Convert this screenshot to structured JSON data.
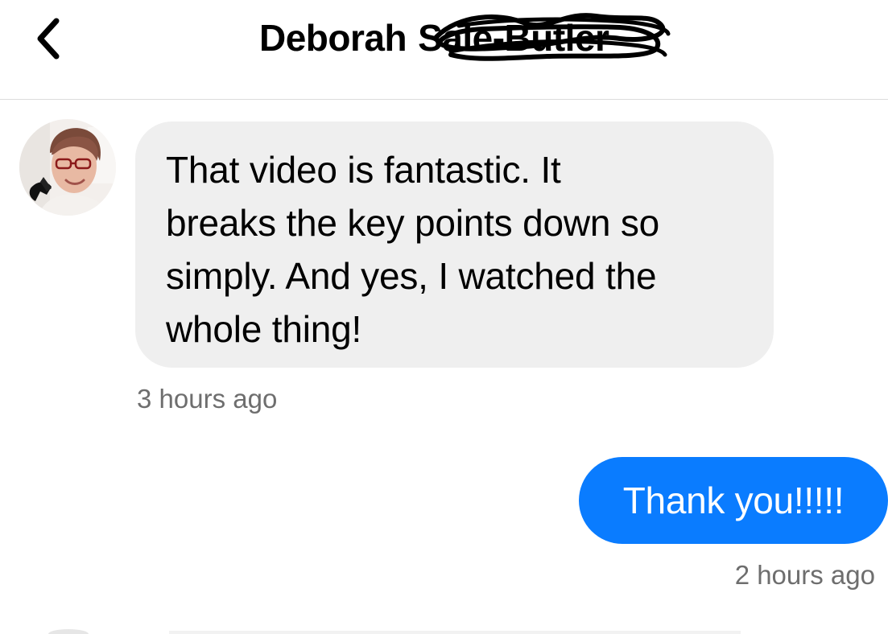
{
  "header": {
    "back_icon": "chevron-left-icon",
    "title_first": "Deborah",
    "title_redacted": "Sale-Butler"
  },
  "conversation": {
    "incoming": {
      "lines": [
        "That video is fantastic.  It",
        "breaks the key points down so",
        "simply.  And yes, I watched the",
        "whole thing!"
      ],
      "timestamp": "3 hours ago"
    },
    "outgoing": {
      "text": "Thank you!!!!!",
      "timestamp": "2 hours ago",
      "bubble_color": "#0a7cff"
    }
  },
  "colors": {
    "incoming_bubble": "#efefef",
    "timestamp": "#6e6e6e",
    "accent": "#0a7cff"
  }
}
